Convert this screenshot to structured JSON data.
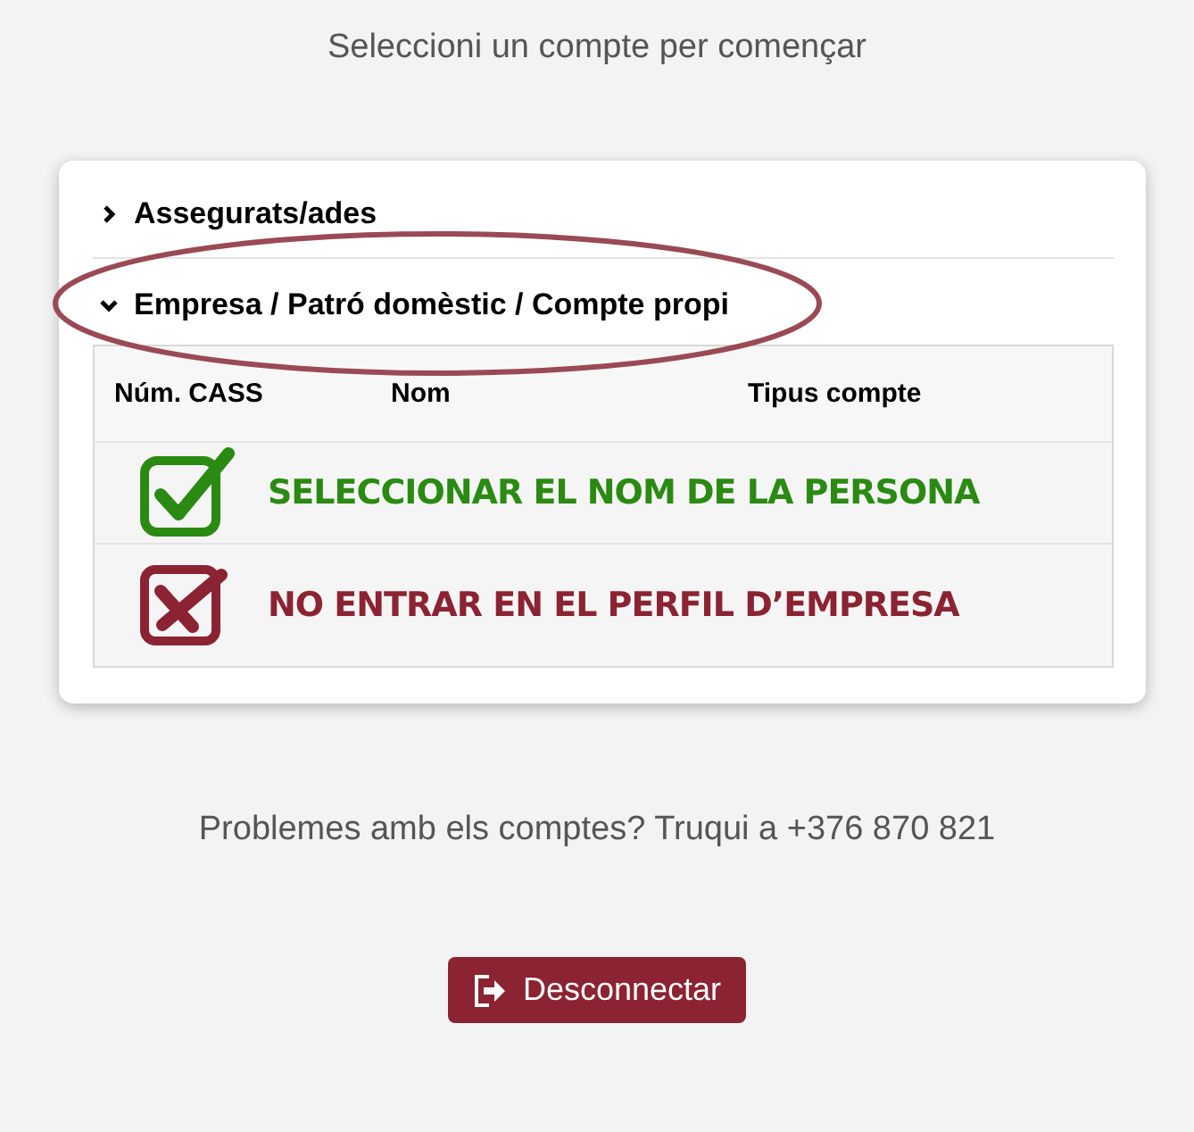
{
  "heading": "Seleccioni un compte per començar",
  "sections": [
    {
      "label": "Assegurats/ades",
      "expanded": false
    },
    {
      "label": "Empresa / Patró domèstic / Compte propi",
      "expanded": true,
      "highlighted": true
    }
  ],
  "table": {
    "columns": [
      "Núm. CASS",
      "Nom",
      "Tipus compte"
    ],
    "rows": [
      {
        "kind": "check",
        "text": "SELECCIONAR EL NOM DE LA PERSONA",
        "color": "#2a8a12"
      },
      {
        "kind": "cross",
        "text": "NO ENTRAR EN EL PERFIL D’EMPRESA",
        "color": "#8b2332"
      }
    ]
  },
  "help": "Problemes amb els comptes? Truqui a +376 870 821",
  "logout_button": "Desconnectar"
}
